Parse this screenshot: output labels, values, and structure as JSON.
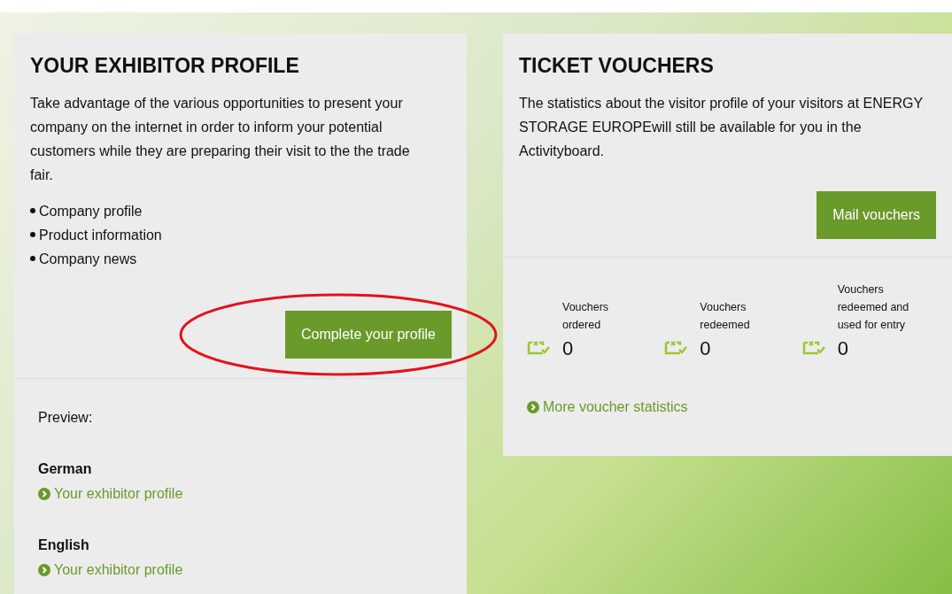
{
  "profile_card": {
    "title": "YOUR EXHIBITOR PROFILE",
    "description": "Take advantage of the various opportunities to present your company on the internet in order to inform your potential customers while they are preparing their visit to the the trade fair.",
    "bullets": [
      "Company profile",
      "Product information",
      "Company news"
    ],
    "button": "Complete your profile",
    "highlighted": true,
    "preview_label": "Preview:",
    "previews": [
      {
        "language": "German",
        "link": "Your exhibitor profile"
      },
      {
        "language": "English",
        "link": "Your exhibitor profile"
      }
    ]
  },
  "vouchers_card": {
    "title": "TICKET VOUCHERS",
    "description": "The statistics about the visitor profile of your visitors at ENERGY STORAGE EUROPEwill still be available for you in the Activityboard.",
    "button": "Mail vouchers",
    "stats": [
      {
        "label": "Vouchers ordered",
        "value": "0"
      },
      {
        "label": "Vouchers redeemed",
        "value": "0"
      },
      {
        "label": "Vouchers redeemed and used for entry",
        "value": "0"
      }
    ],
    "link": "More voucher statistics"
  }
}
